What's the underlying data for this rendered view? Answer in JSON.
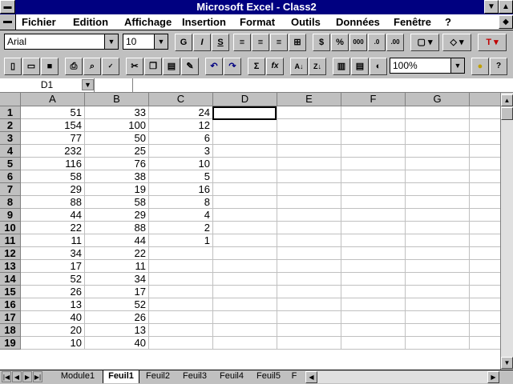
{
  "window": {
    "title": "Microsoft Excel - Class2"
  },
  "menu": [
    "Fichier",
    "Edition",
    "Affichage",
    "Insertion",
    "Format",
    "Outils",
    "Données",
    "Fenêtre",
    "?"
  ],
  "format_toolbar": {
    "font": "Arial",
    "size": "10",
    "bold": "G",
    "italic": "I",
    "underline": "S"
  },
  "standard_toolbar": {
    "zoom": "100%"
  },
  "formula_bar": {
    "name_box": "D1",
    "content": ""
  },
  "columns": [
    "A",
    "B",
    "C",
    "D",
    "E",
    "F",
    "G"
  ],
  "rows": [
    {
      "n": "1",
      "a": "51",
      "b": "33",
      "c": "24"
    },
    {
      "n": "2",
      "a": "154",
      "b": "100",
      "c": "12"
    },
    {
      "n": "3",
      "a": "77",
      "b": "50",
      "c": "6"
    },
    {
      "n": "4",
      "a": "232",
      "b": "25",
      "c": "3"
    },
    {
      "n": "5",
      "a": "116",
      "b": "76",
      "c": "10"
    },
    {
      "n": "6",
      "a": "58",
      "b": "38",
      "c": "5"
    },
    {
      "n": "7",
      "a": "29",
      "b": "19",
      "c": "16"
    },
    {
      "n": "8",
      "a": "88",
      "b": "58",
      "c": "8"
    },
    {
      "n": "9",
      "a": "44",
      "b": "29",
      "c": "4"
    },
    {
      "n": "10",
      "a": "22",
      "b": "88",
      "c": "2"
    },
    {
      "n": "11",
      "a": "11",
      "b": "44",
      "c": "1"
    },
    {
      "n": "12",
      "a": "34",
      "b": "22",
      "c": ""
    },
    {
      "n": "13",
      "a": "17",
      "b": "11",
      "c": ""
    },
    {
      "n": "14",
      "a": "52",
      "b": "34",
      "c": ""
    },
    {
      "n": "15",
      "a": "26",
      "b": "17",
      "c": ""
    },
    {
      "n": "16",
      "a": "13",
      "b": "52",
      "c": ""
    },
    {
      "n": "17",
      "a": "40",
      "b": "26",
      "c": ""
    },
    {
      "n": "18",
      "a": "20",
      "b": "13",
      "c": ""
    },
    {
      "n": "19",
      "a": "10",
      "b": "40",
      "c": ""
    }
  ],
  "sheet_tabs": [
    "Module1",
    "Feuil1",
    "Feuil2",
    "Feuil3",
    "Feuil4",
    "Feuil5",
    "F"
  ],
  "active_tab": "Feuil1"
}
